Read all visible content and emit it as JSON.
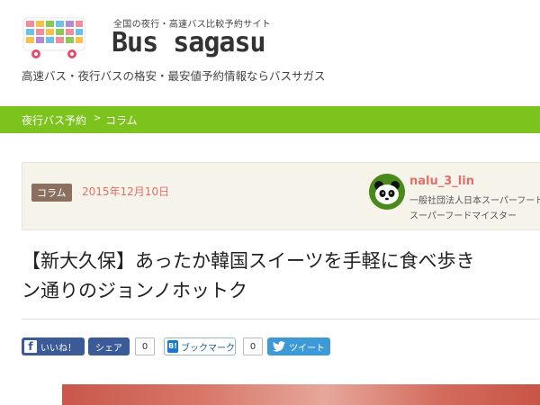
{
  "header": {
    "tagline": "全国の夜行・高速バス比較予約サイト",
    "site_name": "Bus sagasu",
    "description": "高速バス・夜行バスの格安・最安値予約情報ならバスサガス"
  },
  "breadcrumb": {
    "items": [
      "夜行バス予約",
      "コラム"
    ],
    "separator": ">"
  },
  "article": {
    "category": "コラム",
    "date": "2015年12月10日",
    "title_line1": "【新大久保】あったか韓国スイーツを手軽に食べ歩き",
    "title_line2": "ン通りのジョンノホットク",
    "author": {
      "name": "nalu_3_lin",
      "role1": "一般社団法人日本スーパーフード",
      "role2": "スーパーフードマイスター"
    }
  },
  "share": {
    "fb_like_label": "いいね！",
    "fb_share_label": "シェア",
    "fb_count": "0",
    "hatena_label": "ブックマーク",
    "hatena_icon_text": "B!",
    "hatena_count": "0",
    "tweet_label": "ツイート"
  },
  "colors": {
    "accent_green": "#7cc31e",
    "date_pink": "#e0706a",
    "category_brown": "#8b7060",
    "facebook_blue": "#3b5b98",
    "twitter_blue": "#3d9ad8"
  },
  "icons": [
    "bus-logo-icon",
    "facebook-icon",
    "hatena-bookmark-icon",
    "twitter-bird-icon",
    "panda-avatar-icon"
  ]
}
